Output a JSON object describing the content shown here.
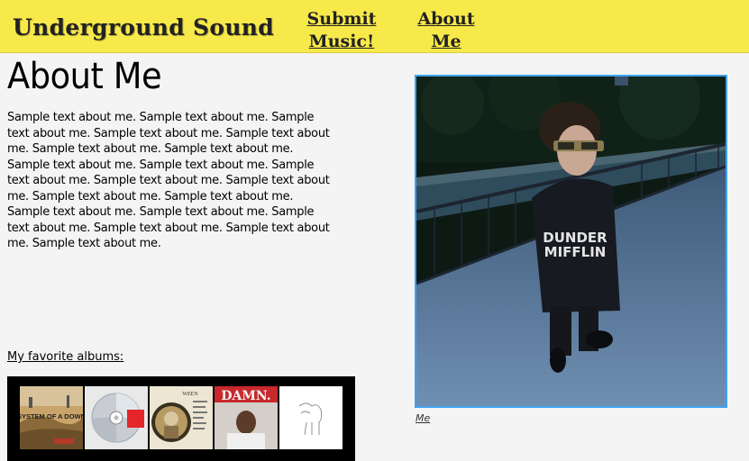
{
  "header": {
    "brand": "Underground Sound",
    "nav": {
      "submit_line1": "Submit",
      "submit_line2": "Music!",
      "about_line1": "About",
      "about_line2": "Me"
    }
  },
  "main": {
    "title": "About Me",
    "body": "Sample text about me. Sample text about me. Sample text about me. Sample text about me. Sample text about me. Sample text about me. Sample text about me. Sample text about me. Sample text about me. Sample text about me. Sample text about me. Sample text about me. Sample text about me. Sample text about me. Sample text about me. Sample text about me. Sample text about me. Sample text about me. Sample text about me. Sample text about me.",
    "albums_heading": "My favorite albums:",
    "albums": [
      {
        "name": "system-of-a-down-toxicity-album-cover",
        "cover_text": "SYSTEM OF A DOWN"
      },
      {
        "name": "yeezus-album-cover"
      },
      {
        "name": "ween-album-cover",
        "cover_text": "WEEN"
      },
      {
        "name": "damn-album-cover",
        "cover_text": "DAMN."
      },
      {
        "name": "white-pony-album-cover"
      }
    ],
    "photo_caption": "Me",
    "photo_shirt_text": [
      "DUNDER",
      "MIFFLIN"
    ]
  },
  "colors": {
    "header_bg": "#f8e94a",
    "page_bg": "#f4f4f4",
    "photo_border": "#3ea3f0",
    "album_strip_bg": "#000000"
  }
}
